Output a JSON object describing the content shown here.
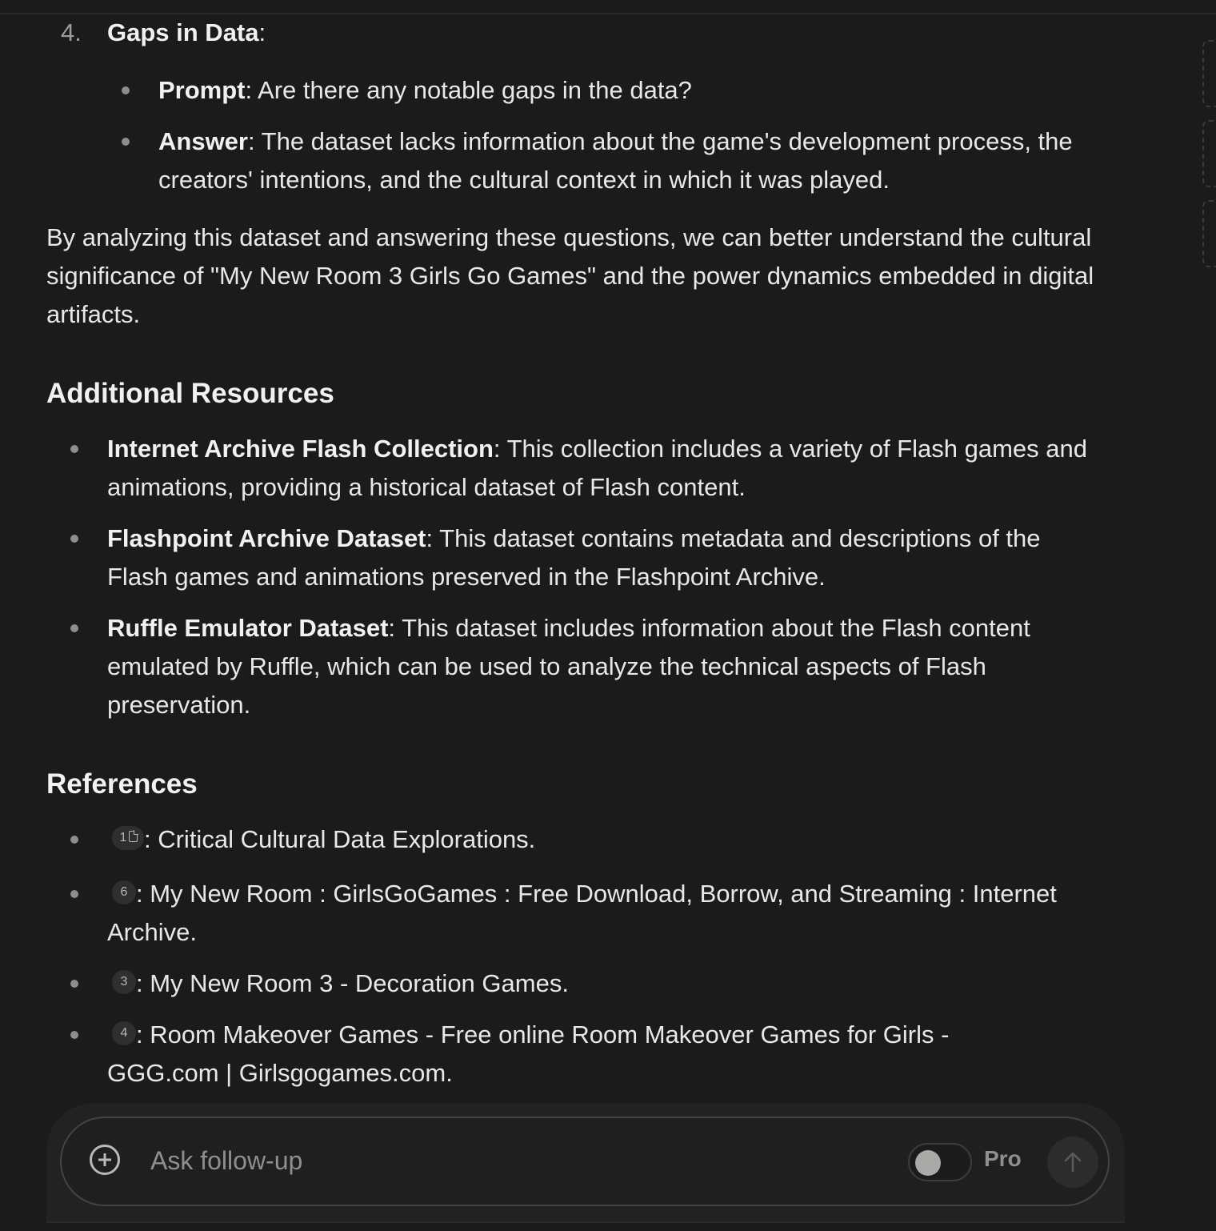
{
  "gaps": {
    "number": "4.",
    "title": "Gaps in Data",
    "prompt_label": "Prompt",
    "prompt_text": ": Are there any notable gaps in the data?",
    "answer_label": "Answer",
    "answer_text": ": The dataset lacks information about the game's development process, the creators' intentions, and the cultural context in which it was played."
  },
  "summary_paragraph": "By analyzing this dataset and answering these questions, we can better understand the cultural significance of \"My New Room 3 Girls Go Games\" and the power dynamics embedded in digital artifacts.",
  "additional_resources": {
    "heading": "Additional Resources",
    "items": [
      {
        "label": "Internet Archive Flash Collection",
        "text": ": This collection includes a variety of Flash games and animations, providing a historical dataset of Flash content."
      },
      {
        "label": "Flashpoint Archive Dataset",
        "text": ": This dataset contains metadata and descriptions of the Flash games and animations preserved in the Flashpoint Archive."
      },
      {
        "label": "Ruffle Emulator Dataset",
        "text": ": This dataset includes information about the Flash content emulated by Ruffle, which can be used to analyze the technical aspects of Flash preservation."
      }
    ]
  },
  "references": {
    "heading": "References",
    "items": [
      {
        "cite": "1",
        "cite_icon": "document-icon",
        "text": ": Critical Cultural Data Explorations."
      },
      {
        "cite": "6",
        "text": ": My New Room : GirlsGoGames : Free Download, Borrow, and Streaming : Internet Archive."
      },
      {
        "cite": "3",
        "text": ": My New Room 3 - Decoration Games."
      },
      {
        "cite": "4",
        "text": ": Room Makeover Games - Free online Room Makeover Games for Girls - GGG.com | Girlsgogames.com."
      }
    ]
  },
  "followup": {
    "placeholder": "Ask follow-up",
    "pro_label": "Pro",
    "pro_enabled": false,
    "icons": {
      "attach": "plus-circle-icon",
      "send": "arrow-up-icon"
    }
  }
}
